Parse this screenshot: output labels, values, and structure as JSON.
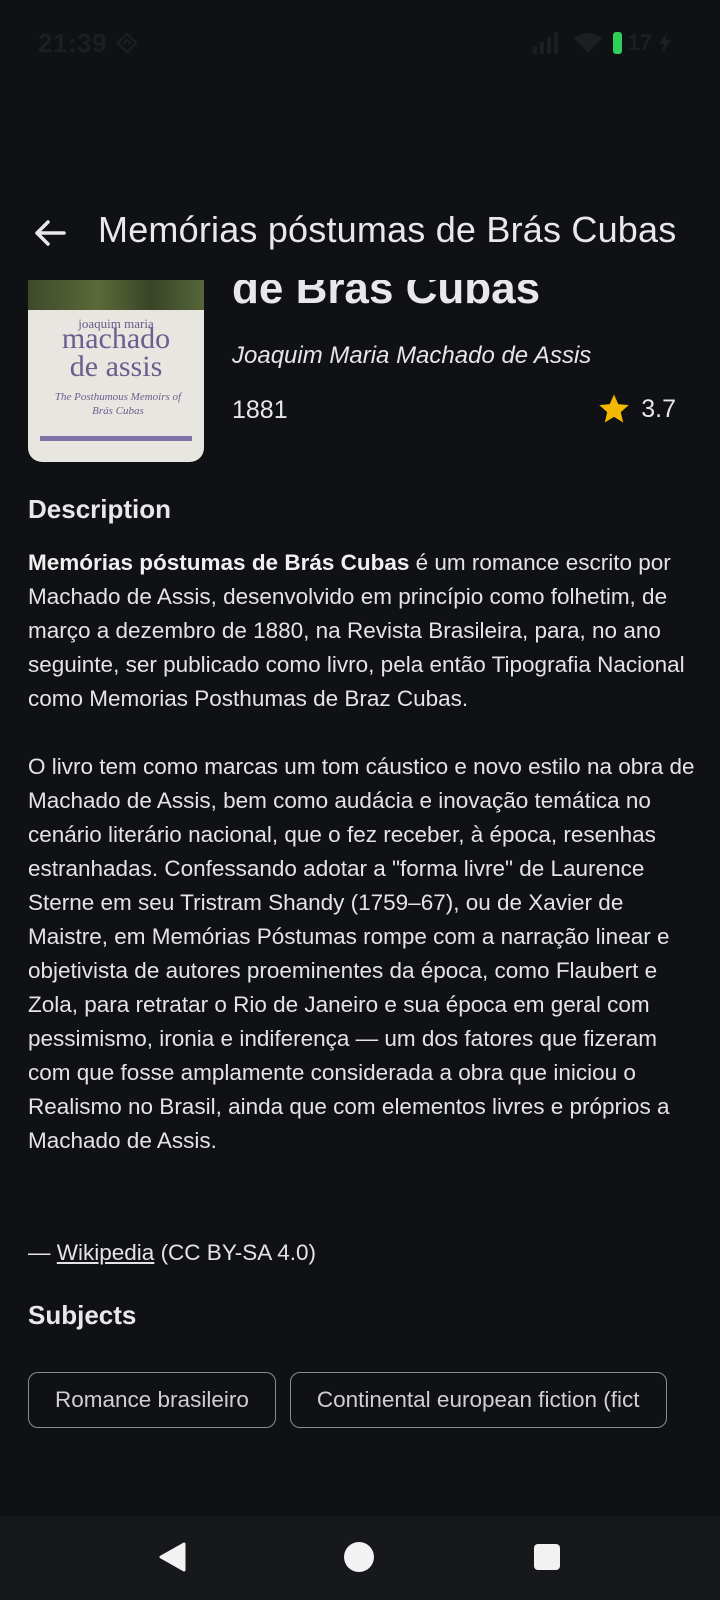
{
  "status_bar": {
    "time": "21:39",
    "battery": "17"
  },
  "app_bar": {
    "title": "Memórias póstumas de Brás Cubas"
  },
  "book": {
    "title_visible": "de Brás Cubas",
    "author": "Joaquim Maria Machado de Assis",
    "year": "1881",
    "rating": "3.7",
    "cover": {
      "author_top": "joaquim maria",
      "name_line1": "machado",
      "name_line2": "de assis",
      "subtitle": "The Posthumous Memoirs of Brás Cubas"
    }
  },
  "description": {
    "heading": "Description",
    "p1_bold": "Memórias póstumas de Brás Cubas",
    "p1_rest": " é um romance escrito por Machado de Assis, desenvolvido em princípio como folhetim, de março a dezembro de 1880, na Revista Brasileira, para, no ano seguinte, ser publicado como livro, pela então Tipografia Nacional como Memorias Posthumas de Braz Cubas.",
    "p2": "O livro tem como marcas um tom cáustico e novo estilo na obra de Machado de Assis, bem como audácia e inovação temática no cenário literário nacional, que o fez receber, à época, resenhas estranhadas. Confessando adotar a \"forma livre\" de Laurence Sterne em seu Tristram Shandy (1759–67), ou de Xavier de Maistre, em Memórias Póstumas rompe com a narração linear e objetivista de autores proeminentes da época, como Flaubert e Zola, para retratar o Rio de Janeiro e sua época em geral com pessimismo, ironia e indiferença — um dos fatores que fizeram com que fosse amplamente considerada a obra que iniciou o Realismo no Brasil, ainda que com elementos livres e próprios a Machado de Assis.",
    "attribution_prefix": "— ",
    "attribution_link": "Wikipedia",
    "attribution_suffix": " (CC BY-SA 4.0)"
  },
  "subjects": {
    "heading": "Subjects",
    "chips": [
      "Romance brasileiro",
      "Continental european fiction (fict"
    ]
  },
  "colors": {
    "background": "#0f1115",
    "star": "#f5b800",
    "battery": "#2fd05a"
  }
}
